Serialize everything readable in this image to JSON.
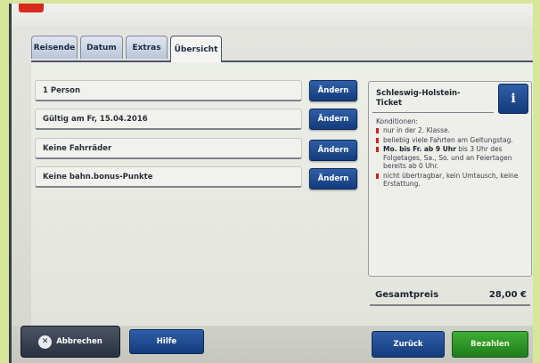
{
  "tabs": [
    {
      "label": "Reisende",
      "active": false
    },
    {
      "label": "Datum",
      "active": false
    },
    {
      "label": "Extras",
      "active": false
    },
    {
      "label": "Übersicht",
      "active": true
    }
  ],
  "summary": {
    "rows": [
      {
        "label": "1 Person",
        "button": "Ändern"
      },
      {
        "label": "Gültig am Fr, 15.04.2016",
        "button": "Ändern"
      },
      {
        "label": "Keine Fahrräder",
        "button": "Ändern"
      },
      {
        "label": "Keine bahn.bonus-Punkte",
        "button": "Ändern"
      }
    ]
  },
  "ticket": {
    "title": "Schleswig-Holstein-Ticket",
    "info_icon": "info-icon",
    "info_glyph": "i",
    "conditions_label": "Konditionen:",
    "conditions": [
      {
        "bold": "",
        "text": "nur in der 2. Klasse."
      },
      {
        "bold": "",
        "text": "beliebig viele Fahrten am Geltungstag."
      },
      {
        "bold": "Mo. bis Fr. ab 9 Uhr",
        "text": " bis 3 Uhr des Folgetages, Sa., So. und an Feiertagen bereits ab 0 Uhr."
      },
      {
        "bold": "",
        "text": "nicht übertragbar, kein Umtausch, keine Erstattung."
      }
    ]
  },
  "total": {
    "label": "Gesamtpreis",
    "value": "28,00 €"
  },
  "footer": {
    "cancel_label": "Abbrechen",
    "cancel_icon": "close-icon",
    "cancel_glyph": "✕",
    "help_label": "Hilfe",
    "back_label": "Zurück",
    "pay_label": "Bezahlen"
  },
  "colors": {
    "accent_blue": "#143b7c",
    "pay_green": "#2a9424",
    "bullet_red": "#c4261c",
    "brand_red": "#d62a1e"
  }
}
